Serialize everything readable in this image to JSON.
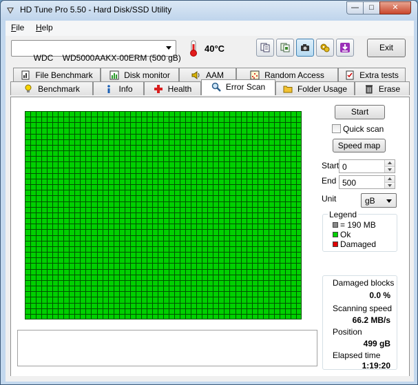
{
  "window": {
    "title": "HD Tune Pro 5.50 - Hard Disk/SSD Utility",
    "minimize_glyph": "—",
    "maximize_glyph": "□",
    "close_glyph": "✕"
  },
  "menu": {
    "file": {
      "accel": "F",
      "rest": "ile"
    },
    "help": {
      "accel": "H",
      "rest": "elp"
    }
  },
  "toolbar": {
    "drive_selected": "WDC    WD5000AAKX-00ERM (500 gB)",
    "temperature": "40°C",
    "buttons": [
      "copy-info-icon",
      "copy-screen-icon",
      "camera-icon",
      "options-icon",
      "download-icon"
    ],
    "exit_label": "Exit"
  },
  "tabs": {
    "row1": [
      {
        "label": "File Benchmark",
        "icon": "file-benchmark-icon"
      },
      {
        "label": "Disk monitor",
        "icon": "disk-monitor-icon"
      },
      {
        "label": "AAM",
        "icon": "speaker-icon"
      },
      {
        "label": "Random Access",
        "icon": "random-access-icon"
      },
      {
        "label": "Extra tests",
        "icon": "extra-tests-icon"
      }
    ],
    "row2": [
      {
        "label": "Benchmark",
        "icon": "lightbulb-icon"
      },
      {
        "label": "Info",
        "icon": "info-icon"
      },
      {
        "label": "Health",
        "icon": "health-cross-icon"
      },
      {
        "label": "Error Scan",
        "icon": "magnifier-icon",
        "active": true
      },
      {
        "label": "Folder Usage",
        "icon": "folder-icon"
      },
      {
        "label": "Erase",
        "icon": "trash-icon"
      }
    ]
  },
  "scan_map": {
    "columns": 50,
    "rows": 37,
    "block_state": "ok",
    "ok_color": "#00d000",
    "damaged_color": "#e00000",
    "grid_line_color": "#005000"
  },
  "controls": {
    "start_label": "Start",
    "quick_scan_label": "Quick scan",
    "quick_scan_checked": false,
    "speed_map_label": "Speed map",
    "start_field_label": "Start",
    "start_value": "0",
    "end_field_label": "End",
    "end_value": "500",
    "unit_label": "Unit",
    "unit_value": "gB"
  },
  "legend": {
    "title": "Legend",
    "block_size": "= 190 MB",
    "ok": "Ok",
    "damaged": "Damaged"
  },
  "stats": {
    "damaged_blocks_label": "Damaged blocks",
    "damaged_blocks_value": "0.0 %",
    "scanning_speed_label": "Scanning speed",
    "scanning_speed_value": "66.2 MB/s",
    "position_label": "Position",
    "position_value": "499 gB",
    "elapsed_time_label": "Elapsed time",
    "elapsed_time_value": "1:19:20"
  }
}
